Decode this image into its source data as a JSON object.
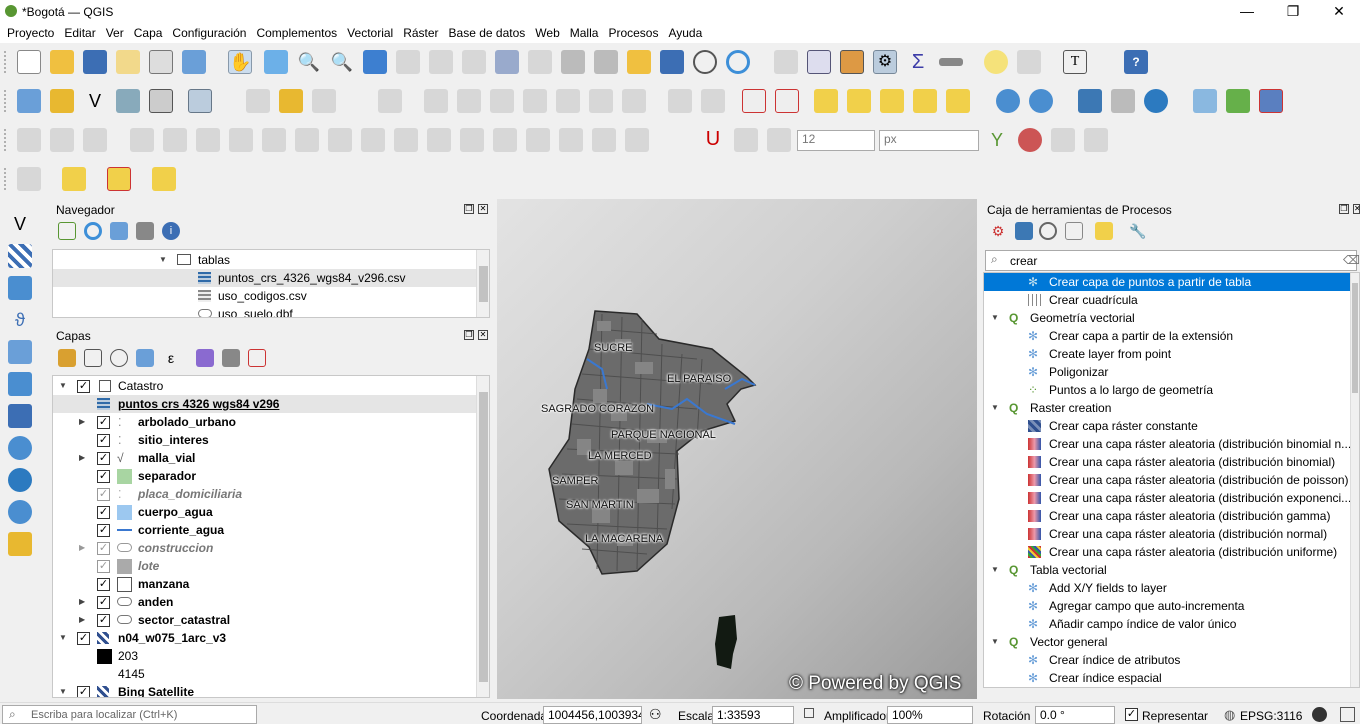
{
  "window": {
    "title": "*Bogotá — QGIS",
    "minimize": "—",
    "maximize": "❐",
    "close": "✕"
  },
  "menu": [
    "Proyecto",
    "Editar",
    "Ver",
    "Capa",
    "Configuración",
    "Complementos",
    "Vectorial",
    "Ráster",
    "Base de datos",
    "Web",
    "Malla",
    "Procesos",
    "Ayuda"
  ],
  "navigator": {
    "title": "Navegador",
    "items": [
      {
        "label": "tablas",
        "icon": "folder-icon"
      },
      {
        "label": "puntos_crs_4326_wgs84_v296.csv",
        "icon": "table-icon"
      },
      {
        "label": "uso_codigos.csv",
        "icon": "table-icon"
      },
      {
        "label": "uso_suelo.dbf",
        "icon": "polygon-layer-icon"
      }
    ]
  },
  "layers": {
    "title": "Capas",
    "items": [
      {
        "label": "Catastro",
        "type": "group"
      },
      {
        "label": "puntos crs 4326 wgs84 v296",
        "type": "active"
      },
      {
        "label": "arbolado_urbano"
      },
      {
        "label": "sitio_interes"
      },
      {
        "label": "malla_vial"
      },
      {
        "label": "separador"
      },
      {
        "label": "placa_domiciliaria"
      },
      {
        "label": "cuerpo_agua"
      },
      {
        "label": "corriente_agua"
      },
      {
        "label": "construccion"
      },
      {
        "label": "lote"
      },
      {
        "label": "manzana"
      },
      {
        "label": "anden"
      },
      {
        "label": "sector_catastral"
      },
      {
        "label": "n04_w075_1arc_v3"
      },
      {
        "label": "203"
      },
      {
        "label": "4145"
      },
      {
        "label": "Bing Satellite"
      }
    ]
  },
  "map": {
    "labels": [
      "SUCRE",
      "EL PARAISO",
      "SAGRADO CORAZON",
      "PARQUE NACIONAL",
      "LA MERCED",
      "SAMPER",
      "SAN MARTIN",
      "LA MACARENA"
    ],
    "watermark": "© Powered by QGIS"
  },
  "processing": {
    "title": "Caja de herramientas de Procesos",
    "search_value": "crear",
    "items": [
      {
        "label": "Crear capa de puntos a partir de tabla",
        "level": 2
      },
      {
        "label": "Crear cuadrícula",
        "level": 2
      },
      {
        "label": "Geometría vectorial",
        "level": 1
      },
      {
        "label": "Crear capa a partir de la extensión",
        "level": 2
      },
      {
        "label": "Create layer from point",
        "level": 2
      },
      {
        "label": "Poligonizar",
        "level": 2
      },
      {
        "label": "Puntos a lo largo de geometría",
        "level": 2
      },
      {
        "label": "Raster creation",
        "level": 1
      },
      {
        "label": "Crear capa ráster constante",
        "level": 2
      },
      {
        "label": "Crear una capa ráster aleatoria (distribución binomial n...",
        "level": 2
      },
      {
        "label": "Crear una capa ráster aleatoria (distribución binomial)",
        "level": 2
      },
      {
        "label": "Crear una capa ráster aleatoria (distribución de poisson)",
        "level": 2
      },
      {
        "label": "Crear una capa ráster aleatoria (distribución exponenci...",
        "level": 2
      },
      {
        "label": "Crear una capa ráster aleatoria (distribución gamma)",
        "level": 2
      },
      {
        "label": "Crear una capa ráster aleatoria (distribución normal)",
        "level": 2
      },
      {
        "label": "Crear una capa ráster aleatoria (distribución uniforme)",
        "level": 2
      },
      {
        "label": "Tabla vectorial",
        "level": 1
      },
      {
        "label": "Add X/Y fields to layer",
        "level": 2
      },
      {
        "label": "Agregar campo que auto-incrementa",
        "level": 2
      },
      {
        "label": "Añadir campo índice de valor único",
        "level": 2
      },
      {
        "label": "Vector general",
        "level": 1
      },
      {
        "label": "Crear índice de atributos",
        "level": 2
      },
      {
        "label": "Crear índice espacial",
        "level": 2
      }
    ]
  },
  "snapping": {
    "tolerance": "12",
    "units": "px"
  },
  "status": {
    "locator_placeholder": "Escriba para localizar (Ctrl+K)",
    "coord_label": "Coordenada",
    "coord_value": "1004456,1003934",
    "scale_label": "Escala",
    "scale_value": "1:33593",
    "magnifier_label": "Amplificador",
    "magnifier_value": "100%",
    "rotation_label": "Rotación",
    "rotation_value": "0.0 °",
    "render_label": "Representar",
    "crs": "EPSG:3116"
  },
  "colors": {
    "accent": "#0078d7",
    "qgis_green": "#589632",
    "selection": "#cce8ff"
  }
}
